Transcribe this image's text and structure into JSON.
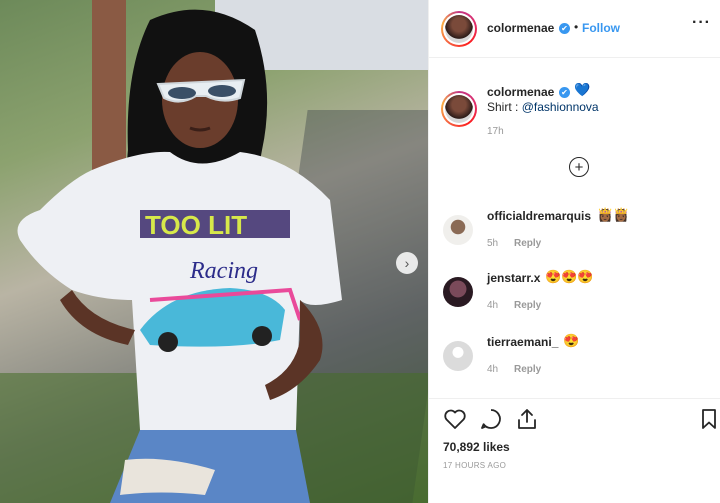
{
  "post": {
    "photo_alt": "",
    "header": {
      "username": "colormenae",
      "verified": "✔",
      "dot": "•",
      "follow_label": "Follow",
      "more_label": "···"
    },
    "caption": {
      "username": "colormenae",
      "verified": "✔",
      "heart": "💙",
      "text_prefix": "Shirt : ",
      "mention": "@fashionnova",
      "time": "17h"
    },
    "load_more_label": "+",
    "comments": [
      {
        "username": "officialdremarquis",
        "emoji": "👸🏾👸🏾",
        "time": "5h",
        "reply_label": "Reply",
        "avatar_color": "#c9c3b8"
      },
      {
        "username": "jenstarr.x",
        "emoji": "😍😍😍",
        "time": "4h",
        "reply_label": "Reply",
        "avatar_color": "#3b2a2d"
      },
      {
        "username": "tierraemani_",
        "emoji": "😍",
        "time": "4h",
        "reply_label": "Reply",
        "avatar_color": "#dbdbdb"
      }
    ],
    "likes_text": "70,892 likes",
    "posted_ago": "17 HOURS AGO",
    "next_arrow": "›"
  },
  "colors": {
    "link_blue": "#3897f0",
    "text": "#262626",
    "muted": "#999999"
  },
  "icons": [
    "heart-icon",
    "comment-icon",
    "share-icon",
    "bookmark-icon",
    "plus-circle-icon",
    "chevron-right-icon",
    "verified-icon",
    "more-icon"
  ]
}
